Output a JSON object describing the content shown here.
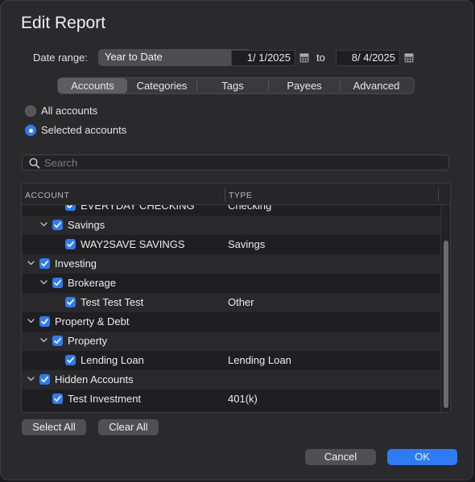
{
  "dialog": {
    "title": "Edit Report"
  },
  "date_range": {
    "label": "Date range:",
    "selected": "Year to Date",
    "from": "1/  1/2025",
    "to_label": "to",
    "to": "8/  4/2025"
  },
  "tabs": [
    {
      "label": "Accounts",
      "active": true
    },
    {
      "label": "Categories",
      "active": false
    },
    {
      "label": "Tags",
      "active": false
    },
    {
      "label": "Payees",
      "active": false
    },
    {
      "label": "Advanced",
      "active": false
    }
  ],
  "scope": {
    "all_label": "All accounts",
    "selected_label": "Selected accounts",
    "selected": "selected"
  },
  "search": {
    "placeholder": "Search",
    "value": ""
  },
  "table": {
    "columns": {
      "account": "ACCOUNT",
      "type": "TYPE"
    },
    "rows": [
      {
        "level": 2,
        "expandable": false,
        "checked": true,
        "name": "EVERYDAY CHECKING",
        "type": "Checking"
      },
      {
        "level": 1,
        "expandable": true,
        "checked": true,
        "name": "Savings",
        "type": ""
      },
      {
        "level": 2,
        "expandable": false,
        "checked": true,
        "name": "WAY2SAVE SAVINGS",
        "type": "Savings"
      },
      {
        "level": 0,
        "expandable": true,
        "checked": true,
        "name": "Investing",
        "type": ""
      },
      {
        "level": 1,
        "expandable": true,
        "checked": true,
        "name": "Brokerage",
        "type": ""
      },
      {
        "level": 2,
        "expandable": false,
        "checked": true,
        "name": "Test Test Test",
        "type": "Other"
      },
      {
        "level": 0,
        "expandable": true,
        "checked": true,
        "name": "Property & Debt",
        "type": ""
      },
      {
        "level": 1,
        "expandable": true,
        "checked": true,
        "name": "Property",
        "type": ""
      },
      {
        "level": 2,
        "expandable": false,
        "checked": true,
        "name": "Lending Loan",
        "type": "Lending Loan"
      },
      {
        "level": 0,
        "expandable": true,
        "checked": true,
        "name": "Hidden Accounts",
        "type": ""
      },
      {
        "level": 1,
        "expandable": false,
        "checked": true,
        "name": "Test Investment",
        "type": "401(k)"
      }
    ]
  },
  "buttons": {
    "select_all": "Select All",
    "clear_all": "Clear All",
    "cancel": "Cancel",
    "ok": "OK"
  },
  "colors": {
    "accent": "#2f7bf5",
    "background": "#2a2a2c"
  }
}
